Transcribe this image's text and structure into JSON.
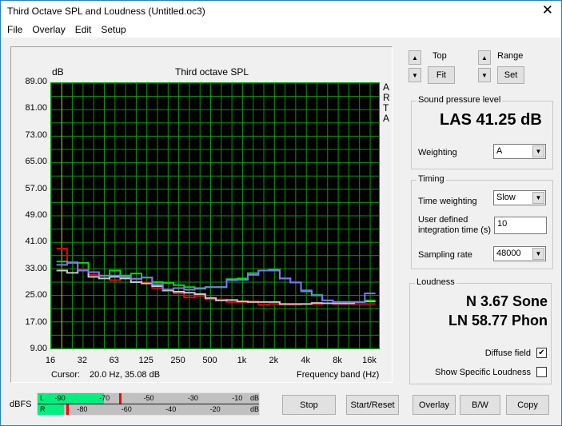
{
  "window": {
    "title": "Third Octave SPL and Loudness (Untitled.oc3)",
    "close_icon": "close-icon"
  },
  "menu": [
    "File",
    "Overlay",
    "Edit",
    "Setup"
  ],
  "chart_data": {
    "type": "line",
    "title": "Third octave SPL",
    "ylabel": "dB",
    "xlabel": "Frequency band (Hz)",
    "watermark": "ARTA",
    "ylim": [
      9,
      89
    ],
    "yticks": [
      "89.00",
      "81.00",
      "73.00",
      "65.00",
      "57.00",
      "49.00",
      "41.00",
      "33.00",
      "25.00",
      "17.00",
      "9.00"
    ],
    "xticks": [
      "16",
      "32",
      "63",
      "125",
      "250",
      "500",
      "1k",
      "2k",
      "4k",
      "8k",
      "16k"
    ],
    "x": [
      "20",
      "25",
      "31.5",
      "40",
      "50",
      "63",
      "80",
      "100",
      "125",
      "160",
      "200",
      "250",
      "315",
      "400",
      "500",
      "630",
      "800",
      "1k",
      "1.25k",
      "1.6k",
      "2k",
      "2.5k",
      "3.15k",
      "4k",
      "5k",
      "6.3k",
      "8k",
      "10k",
      "12.5k",
      "16k"
    ],
    "grid": true,
    "cursor_freq_hz": 20,
    "cursor_color": "#c8b400",
    "series": [
      {
        "color": "#f00000",
        "values": [
          39.1,
          34.8,
          32.8,
          31.2,
          30.9,
          29.6,
          30.4,
          30.1,
          28.8,
          27.2,
          26.4,
          25.6,
          24.4,
          24.8,
          23.8,
          23.8,
          23.0,
          23.0,
          23.2,
          22.2,
          22.4,
          22.2,
          22.2,
          22.4,
          22.4,
          22.6,
          22.4,
          22.4,
          22.4,
          22.4
        ]
      },
      {
        "color": "#c8c8c8",
        "values": [
          32.5,
          31.8,
          32.5,
          30.6,
          30.1,
          30.6,
          30.1,
          29.0,
          28.6,
          27.8,
          26.5,
          26.1,
          25.8,
          25.4,
          24.2,
          23.5,
          23.6,
          23.2,
          23.0,
          23.0,
          23.0,
          22.4,
          22.4,
          22.4,
          22.7,
          22.6,
          22.6,
          22.6,
          23.0,
          23.2
        ]
      },
      {
        "color": "#00e000",
        "values": [
          35.2,
          35.0,
          34.8,
          32.0,
          30.9,
          32.5,
          31.0,
          31.6,
          30.4,
          29.0,
          28.8,
          28.1,
          27.5,
          27.0,
          27.5,
          27.5,
          29.9,
          30.1,
          31.7,
          32.5,
          32.8,
          30.1,
          28.9,
          26.2,
          25.1,
          23.5,
          23.0,
          23.0,
          23.0,
          23.5
        ]
      },
      {
        "color": "#7878ff",
        "values": [
          34.2,
          34.8,
          32.5,
          32.0,
          31.0,
          31.0,
          30.5,
          30.0,
          30.4,
          28.4,
          26.8,
          27.2,
          26.7,
          27.2,
          27.5,
          27.5,
          29.6,
          29.7,
          31.2,
          32.5,
          32.5,
          30.1,
          28.9,
          26.5,
          25.0,
          23.5,
          23.0,
          23.0,
          23.0,
          25.6
        ]
      }
    ]
  },
  "cursor": {
    "label": "Cursor:",
    "value": "20.0 Hz, 35.08 dB"
  },
  "controls": {
    "top_label": "Top",
    "fit": "Fit",
    "range_label": "Range",
    "set": "Set"
  },
  "spl": {
    "group": "Sound pressure level",
    "value": "LAS 41.25 dB",
    "weighting_label": "Weighting",
    "weighting": "A"
  },
  "timing": {
    "group": "Timing",
    "time_weighting_label": "Time weighting",
    "time_weighting": "Slow",
    "integration_label_1": "User defined",
    "integration_label_2": "integration time (s)",
    "integration": "10",
    "sampling_label": "Sampling rate",
    "sampling": "48000"
  },
  "loudness": {
    "group": "Loudness",
    "n": "N 3.67 Sone",
    "ln": "LN 58.77 Phon",
    "diffuse": "Diffuse field",
    "diffuse_checked": true,
    "specific": "Show Specific Loudness",
    "specific_checked": false
  },
  "meter": {
    "label": "dBFS",
    "left": "L",
    "right": "R",
    "unit": "dB",
    "l_ticks": [
      "-90",
      "-70",
      "-50",
      "-30",
      "-10"
    ],
    "r_ticks": [
      "-80",
      "-60",
      "-40",
      "-20"
    ],
    "left_level_dbfs": -70,
    "left_peak_dbfs": -63,
    "right_level_dbfs": -88,
    "right_peak_dbfs": -87,
    "fill_color": "#00f080",
    "peak_color": "#ff0000"
  },
  "buttons": {
    "stop": "Stop",
    "start_reset": "Start/Reset",
    "overlay": "Overlay",
    "bw": "B/W",
    "copy": "Copy"
  }
}
